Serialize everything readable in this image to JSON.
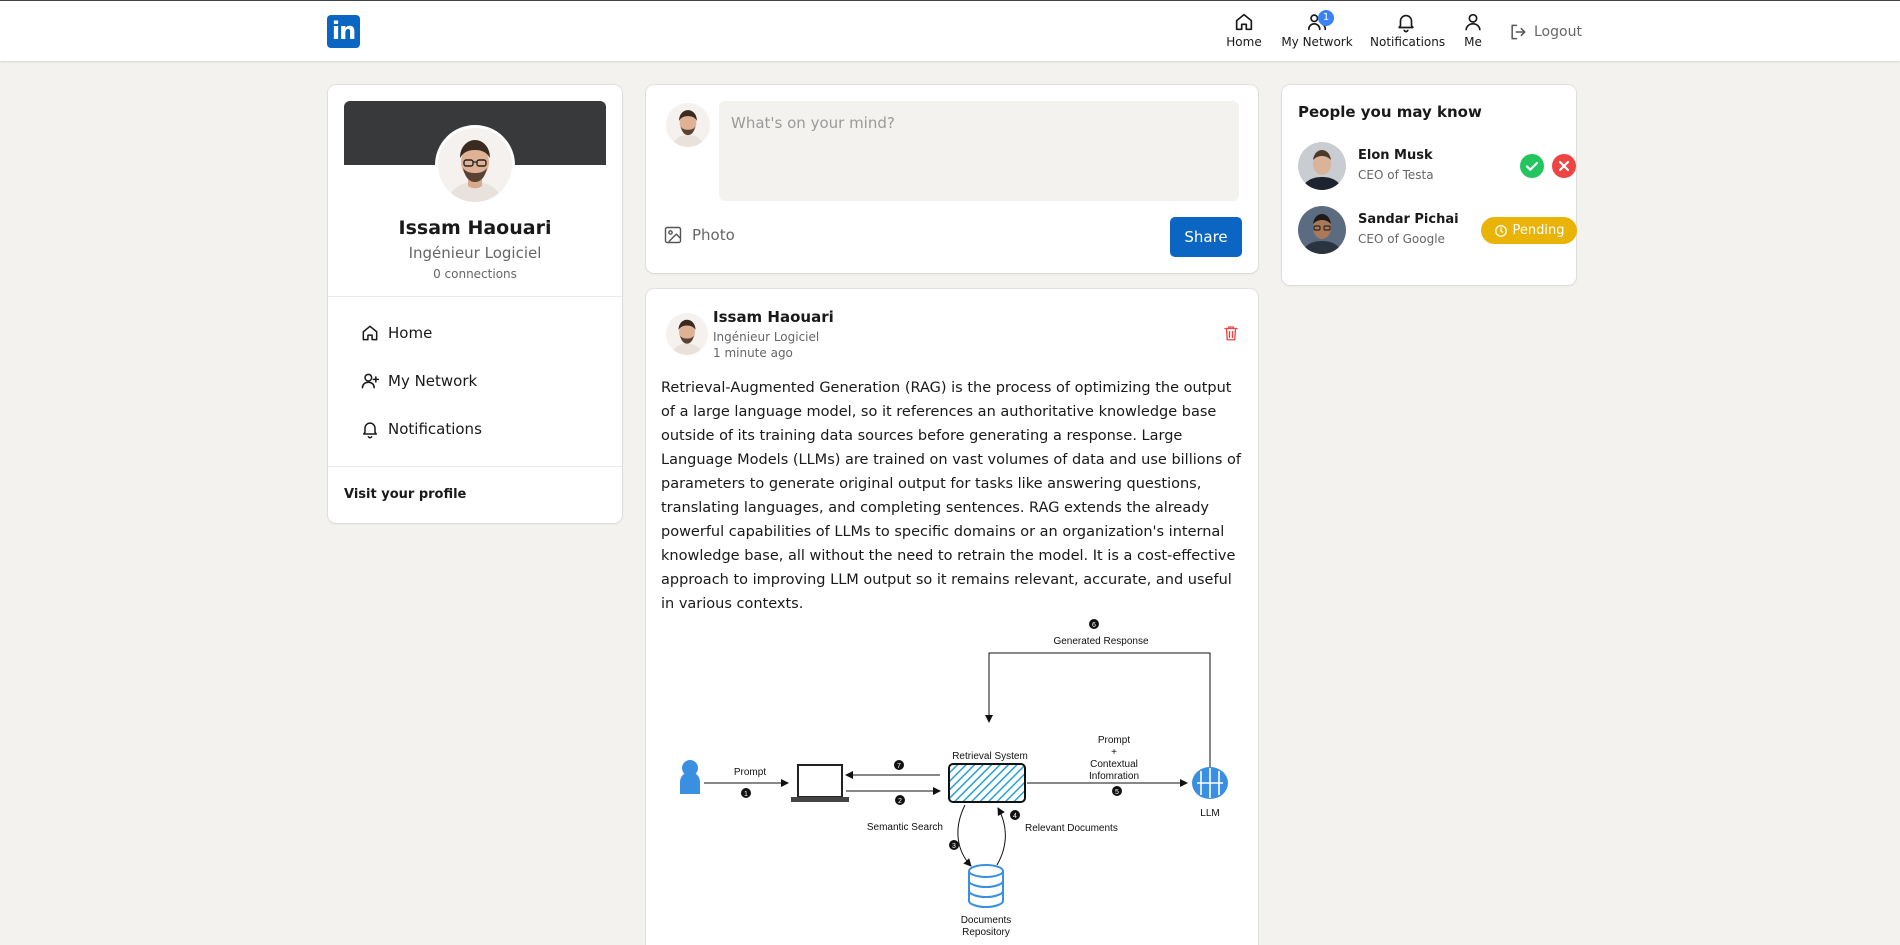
{
  "nav": {
    "logo": "in",
    "items": [
      {
        "label": "Home",
        "icon": "home-icon"
      },
      {
        "label": "My Network",
        "icon": "network-icon",
        "badge": "1"
      },
      {
        "label": "Notifications",
        "icon": "bell-icon"
      },
      {
        "label": "Me",
        "icon": "user-icon"
      }
    ],
    "logout_label": "Logout"
  },
  "profile": {
    "name": "Issam Haouari",
    "headline": "Ingénieur Logiciel",
    "connections": "0 connections",
    "links": [
      {
        "label": "Home",
        "icon": "home-icon"
      },
      {
        "label": "My Network",
        "icon": "user-plus-icon"
      },
      {
        "label": "Notifications",
        "icon": "bell-icon"
      }
    ],
    "visit_profile": "Visit your profile"
  },
  "composer": {
    "placeholder": "What's on your mind?",
    "photo_label": "Photo",
    "share_label": "Share"
  },
  "post": {
    "author": "Issam Haouari",
    "headline": "Ingénieur Logiciel",
    "time": "1 minute ago",
    "text": "Retrieval-Augmented Generation (RAG) is the process of optimizing the output of a large language model, so it references an authoritative knowledge base outside of its training data sources before generating a response. Large Language Models (LLMs) are trained on vast volumes of data and use billions of parameters to generate original output for tasks like answering questions, translating languages, and completing sentences. RAG extends the already powerful capabilities of LLMs to specific domains or an organization's internal knowledge base, all without the need to retrain the model. It is a cost-effective approach to improving LLM output so it remains relevant, accurate, and useful in various contexts.",
    "diagram": {
      "generated_response": "Generated Response",
      "prompt": "Prompt",
      "retrieval_system": "Retrieval System",
      "prompt_context_1": "Prompt",
      "prompt_context_2": "+",
      "prompt_context_3": "Contextual",
      "prompt_context_4": "Infomration",
      "llm": "LLM",
      "semantic_search": "Semantic Search",
      "relevant_documents": "Relevant Documents",
      "documents_repo_1": "Documents",
      "documents_repo_2": "Repository",
      "steps": [
        "1",
        "2",
        "3",
        "4",
        "5",
        "6",
        "7"
      ]
    }
  },
  "people": {
    "title": "People you may know",
    "list": [
      {
        "name": "Elon Musk",
        "title": "CEO of Testa"
      },
      {
        "name": "Sandar Pichai",
        "title": "CEO of Google",
        "status": "Pending"
      }
    ]
  },
  "colors": {
    "brand": "#0a66c2",
    "accept": "#22c55e",
    "reject": "#ef4444",
    "pending": "#eab308",
    "badge": "#3b82f6"
  }
}
